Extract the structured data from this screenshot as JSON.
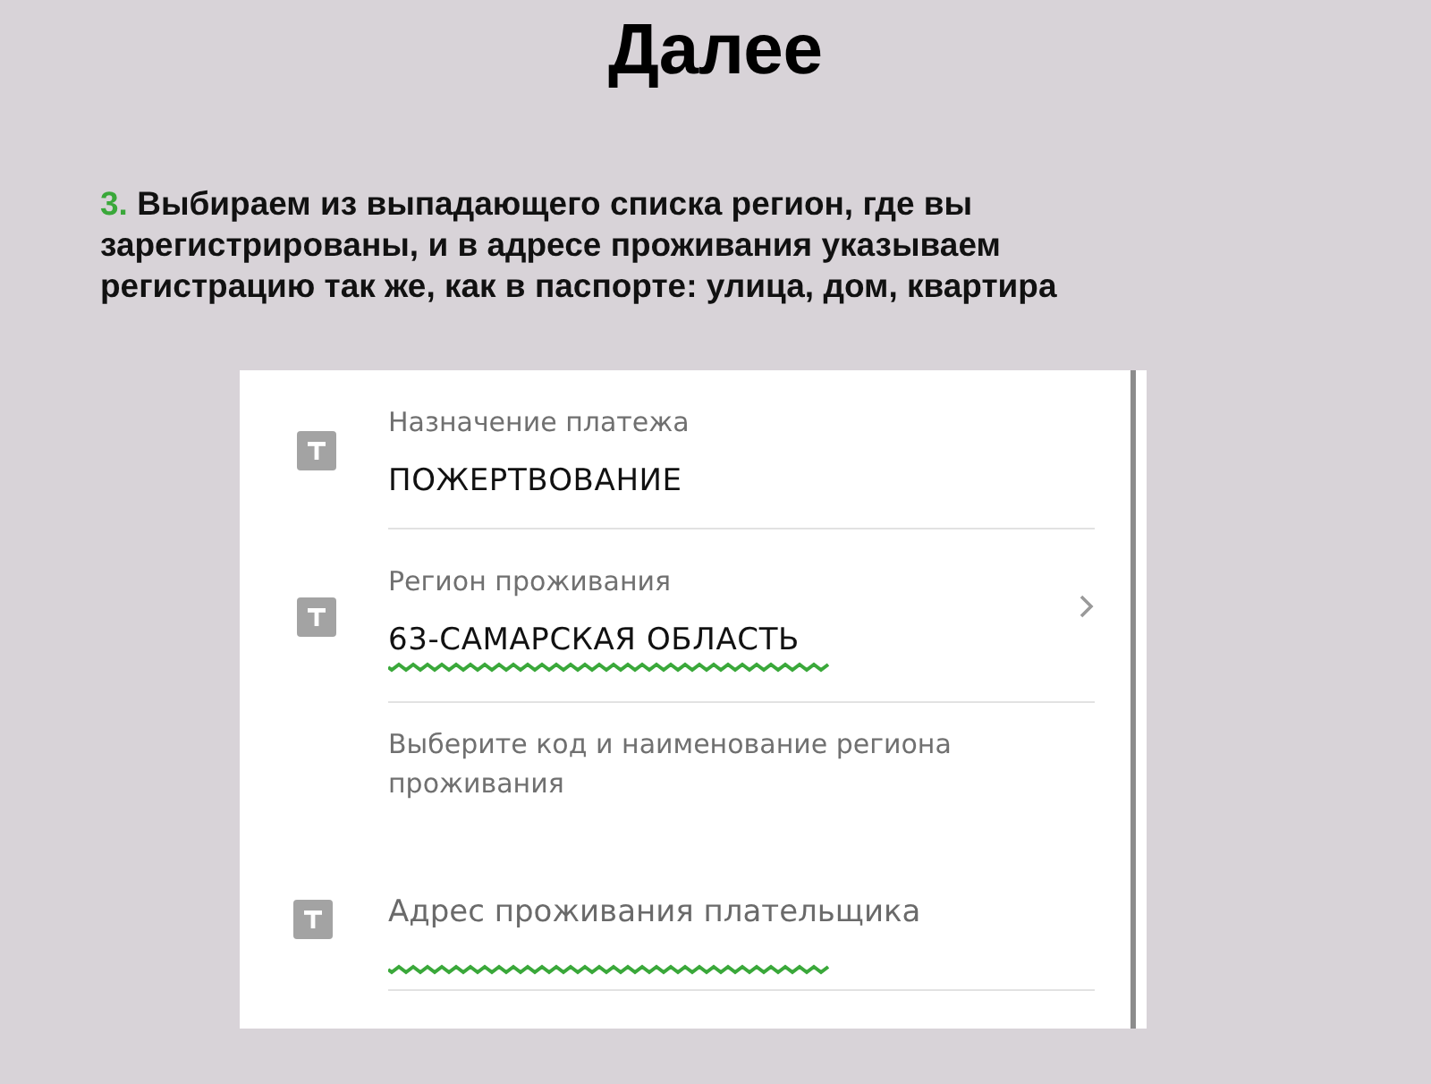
{
  "slide": {
    "title": "Далее",
    "step": {
      "number": "3.",
      "text": "Выбираем из выпадающего списка регион, где вы зарегистрированы, и в адресе проживания указываем регистрацию так же, как в паспорте: улица, дом, квартира"
    }
  },
  "form": {
    "fields": [
      {
        "kind": "filled",
        "label": "Назначение платежа",
        "value": "ПОЖЕРТВОВАНИЕ",
        "underlined": false,
        "chevron": false
      },
      {
        "kind": "filled",
        "label": "Регион проживания",
        "value": "63-САМАРСКАЯ ОБЛАСТЬ",
        "underlined": true,
        "chevron": true
      },
      {
        "kind": "hint",
        "text": "Выберите код и наименование региона проживания"
      },
      {
        "kind": "empty",
        "placeholder": "Адрес проживания плательщика",
        "underlined": true
      }
    ]
  }
}
